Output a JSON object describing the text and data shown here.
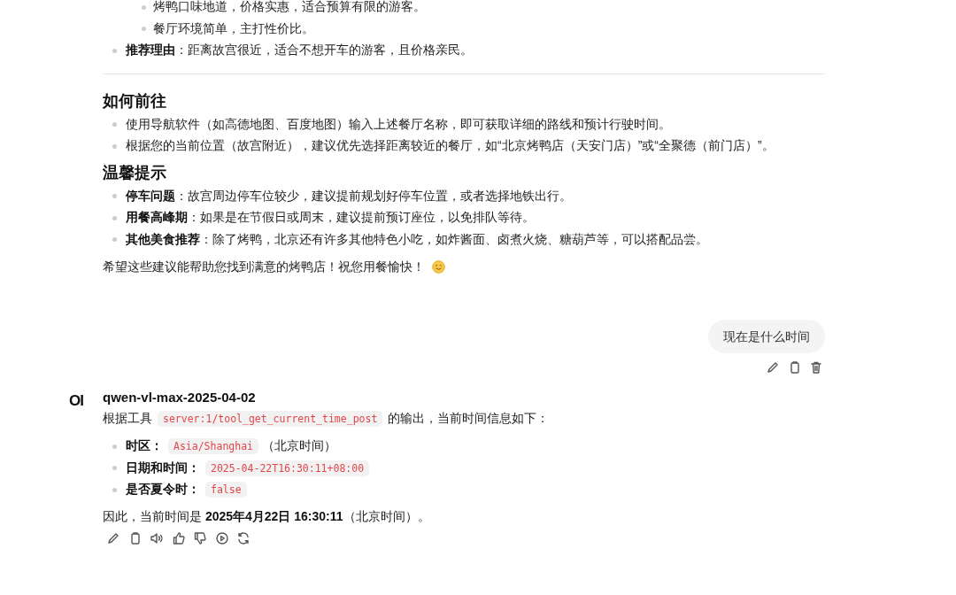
{
  "previous_answer": {
    "sub_bullets": [
      "烤鸭口味地道，价格实惠，适合预算有限的游客。",
      "餐厅环境简单，主打性价比。"
    ],
    "bullets": [
      "**推荐理由**：距离故宫很近，适合不想开车的游客，且价格亲民。"
    ],
    "sections": [
      {
        "heading": "如何前往",
        "items": [
          "使用导航软件（如高德地图、百度地图）输入上述餐厅名称，即可获取详细的路线和预计行驶时间。",
          "根据您的当前位置（故宫附近），建议优先选择距离较近的餐厅，如“北京烤鸭店（天安门店）”或“全聚德（前门店）”。"
        ]
      },
      {
        "heading": "温馨提示",
        "items": [
          "**停车问题**：故宫周边停车位较少，建议提前规划好停车位置，或者选择地铁出行。",
          "**用餐高峰期**：如果是在节假日或周末，建议提前预订座位，以免排队等待。",
          "**其他美食推荐**：除了烤鸭，北京还有许多其他特色小吃，如炸酱面、卤煮火烧、糖葫芦等，可以搭配品尝。"
        ]
      }
    ],
    "closing": "希望这些建议能帮助您找到满意的烤鸭店！祝您用餐愉快！"
  },
  "user_message": {
    "text": "现在是什么时间"
  },
  "assistant_message": {
    "avatar": "OI",
    "model": "qwen-vl-max-2025-04-02",
    "intro": [
      {
        "kind": "text",
        "text": "根据工具"
      },
      {
        "kind": "code",
        "text": "server:1/tool_get_current_time_post"
      },
      {
        "kind": "text",
        "text": "的输出，当前时间信息如下："
      }
    ],
    "bullets": [
      {
        "label": "时区：",
        "code": "Asia/Shanghai",
        "after": "（北京时间）"
      },
      {
        "label": "日期和时间：",
        "code": "2025-04-22T16:30:11+08:00"
      },
      {
        "label": "是否夏令时：",
        "code": "false"
      }
    ],
    "conclusion": "因此，当前时间是 **2025年4月22日 16:30:11**（北京时间）。"
  }
}
